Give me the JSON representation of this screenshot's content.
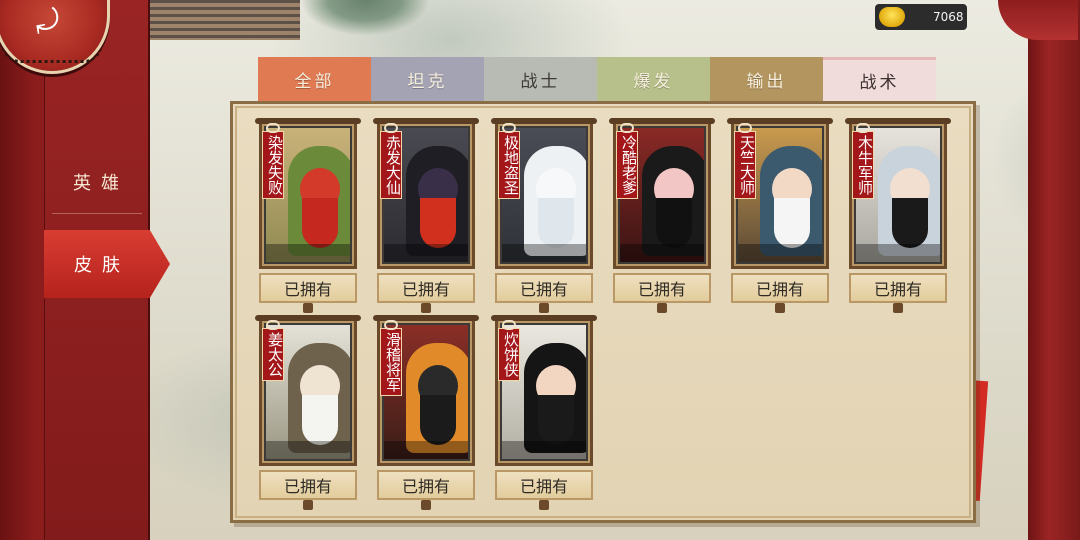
{
  "currency": {
    "icon": "gold-ingot-icon",
    "value": "7068"
  },
  "sidebar": {
    "items": [
      {
        "label": "英雄",
        "active": false
      },
      {
        "label": "皮肤",
        "active": true
      }
    ]
  },
  "tabs": [
    {
      "label": "全部",
      "color": "#e07a52"
    },
    {
      "label": "坦克",
      "color": "#a4a3b3"
    },
    {
      "label": "战士",
      "color": "#b8bbb4"
    },
    {
      "label": "爆发",
      "color": "#b7c08a"
    },
    {
      "label": "输出",
      "color": "#b39560"
    },
    {
      "label": "战术",
      "color": "#f1dcdc"
    }
  ],
  "skins": [
    {
      "name": "染发失败",
      "status": "已拥有"
    },
    {
      "name": "赤发大仙",
      "status": "已拥有"
    },
    {
      "name": "极地盗圣",
      "status": "已拥有"
    },
    {
      "name": "冷酷老爹",
      "status": "已拥有"
    },
    {
      "name": "天竺大师",
      "status": "已拥有"
    },
    {
      "name": "木牛军师",
      "status": "已拥有"
    },
    {
      "name": "姜太公",
      "status": "已拥有"
    },
    {
      "name": "滑稽将军",
      "status": "已拥有"
    },
    {
      "name": "炊饼侠",
      "status": "已拥有"
    }
  ]
}
